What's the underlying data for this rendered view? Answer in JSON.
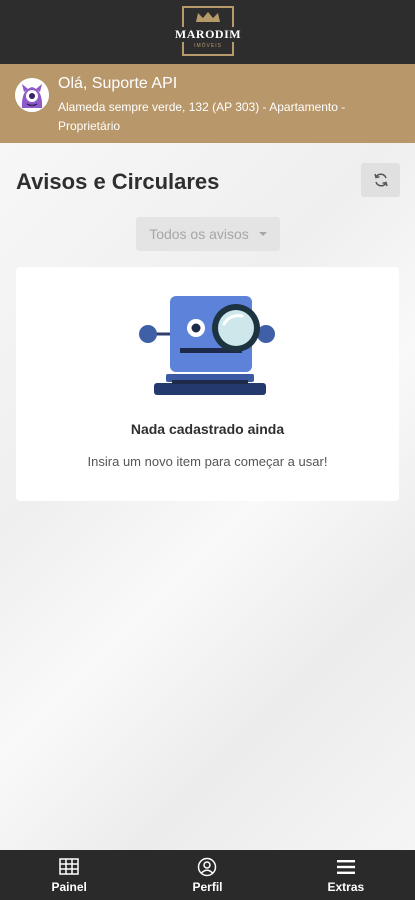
{
  "app": {
    "brand": "MARODIM",
    "brand_sub": "IMÓVEIS"
  },
  "user": {
    "greeting": "Olá, Suporte API",
    "address": "Alameda sempre verde, 132 (AP 303) - Apartamento - Proprietário"
  },
  "main": {
    "title": "Avisos e Circulares",
    "filter": {
      "selected": "Todos os avisos"
    },
    "empty_state": {
      "title": "Nada cadastrado ainda",
      "subtitle": "Insira um novo item para começar a usar!"
    }
  },
  "nav": {
    "items": [
      {
        "label": "Painel",
        "icon": "grid-icon"
      },
      {
        "label": "Perfil",
        "icon": "user-icon"
      },
      {
        "label": "Extras",
        "icon": "menu-icon"
      }
    ]
  },
  "colors": {
    "header_bg": "#2d2d2d",
    "accent_gold": "#b8976a",
    "bottom_nav_bg": "#2a2a2a",
    "robot_blue": "#5c83d9"
  }
}
